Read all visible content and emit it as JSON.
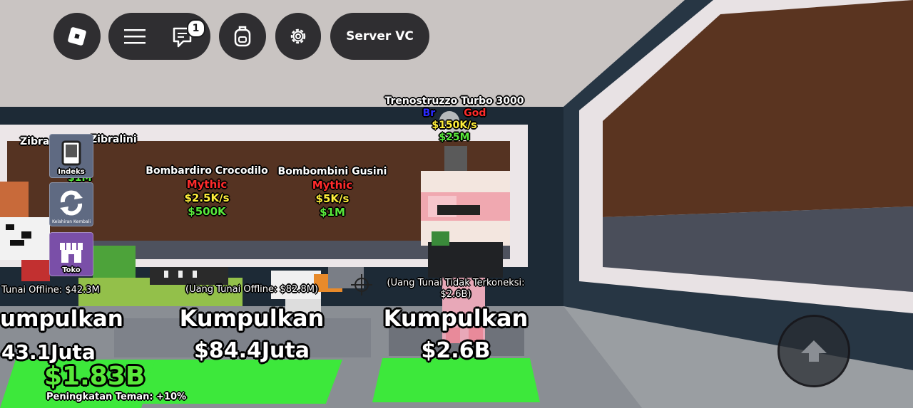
{
  "topbar": {
    "menu_icon": "hamburger-menu-icon",
    "chat_icon": "chat-icon",
    "chat_badge": "1",
    "backpack_icon": "backpack-icon",
    "settings_icon": "gear-icon",
    "server_vc_label": "Server VC"
  },
  "sidebar": {
    "items": [
      {
        "label": "Indeks",
        "icon": "book-icon"
      },
      {
        "label": "Kelahiran Kembali",
        "icon": "rebirth-icon"
      },
      {
        "label": "Toko",
        "icon": "shop-icon"
      }
    ]
  },
  "brainrots": [
    {
      "name": "Zibra",
      "name_partial": "Zibralini",
      "value": "$1M"
    },
    {
      "name": "Bombardiro Crocodilo",
      "rarity": "Mythic",
      "rate": "$2.5K/s",
      "value": "$500K"
    },
    {
      "name": "Bombombini Gusini",
      "rarity": "Mythic",
      "rate": "$5K/s",
      "value": "$1M"
    },
    {
      "name": "Trenostruzzo Turbo 3000",
      "rarity_a": "Br",
      "rarity_b": "God",
      "rate": "$150K/s",
      "value": "$25M"
    }
  ],
  "collectors": [
    {
      "offline": "Tunai Offline: $42.3M",
      "label": "umpulkan",
      "amount": "43.1Juta"
    },
    {
      "offline": "(Uang Tunai Offline: $82.8M)",
      "label": "Kumpulkan",
      "amount": "$84.4Juta"
    },
    {
      "offline_line1": "(Uang Tunai Tidak Terkoneksi:",
      "offline_line2": "$2.6B)",
      "label": "Kumpulkan",
      "amount": "$2.6B"
    }
  ],
  "hud": {
    "cash": "$1.83B",
    "friend_boost": "Peningkatan Teman: +10%",
    "jump_icon": "jump-arrow-icon"
  },
  "colors": {
    "mythic": "#ff2b2b",
    "rate": "#ffee3a",
    "value": "#59e83a",
    "pad": "#3de83b"
  }
}
